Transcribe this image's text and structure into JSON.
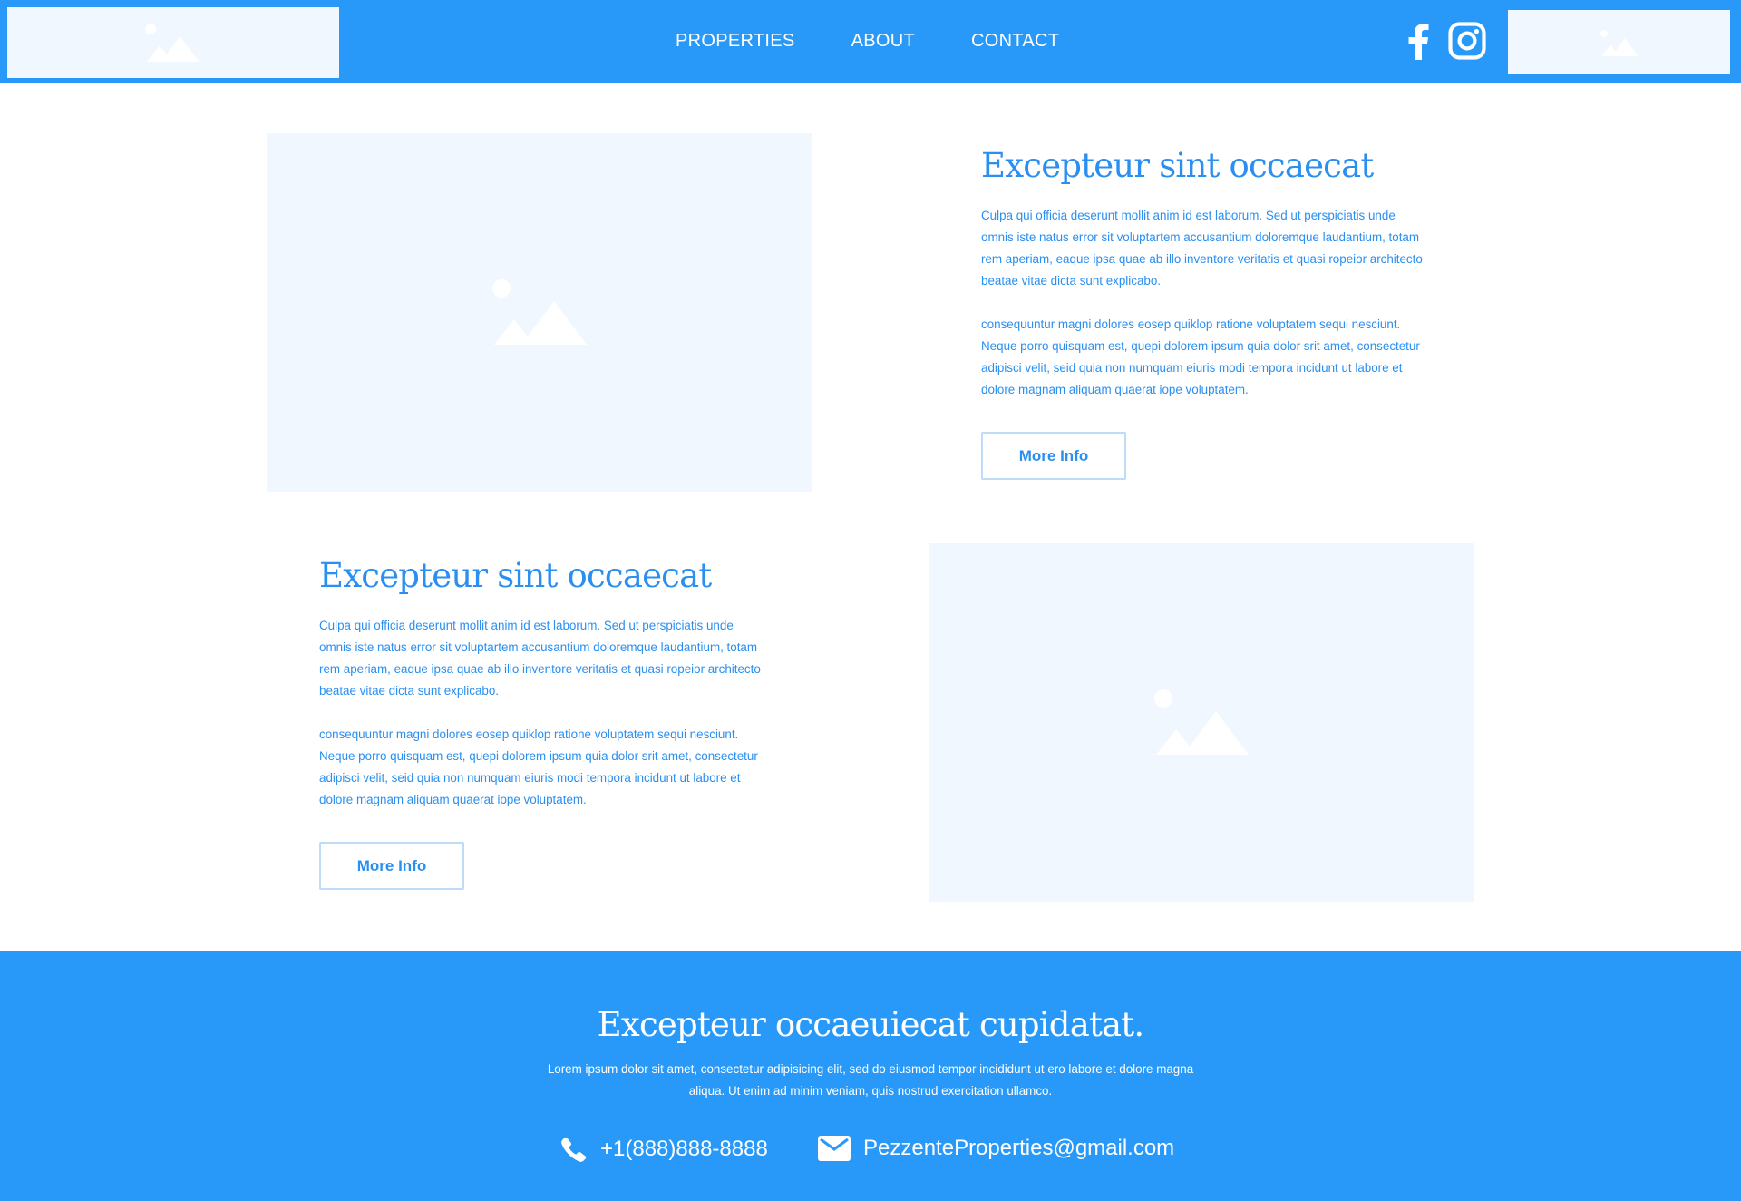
{
  "nav": {
    "items": [
      "PROPERTIES",
      "ABOUT",
      "CONTACT"
    ]
  },
  "social": {
    "facebook": "facebook-icon",
    "instagram": "instagram-icon"
  },
  "sections": [
    {
      "title": "Excepteur sint occaecat",
      "paragraph1": "Culpa qui officia deserunt mollit anim id est laborum. Sed ut perspiciatis unde omnis iste natus error sit voluptartem accusantium doloremque laudantium, totam rem aperiam, eaque ipsa quae ab illo inventore veritatis et quasi ropeior architecto beatae vitae dicta sunt explicabo.",
      "paragraph2": "consequuntur magni dolores eosep quiklop ratione voluptatem sequi nesciunt. Neque porro quisquam est, quepi dolorem ipsum quia dolor srit amet, consectetur adipisci velit, seid quia non numquam eiuris modi tempora incidunt ut labore et dolore magnam aliquam quaerat iope voluptatem.",
      "button": "More Info"
    },
    {
      "title": "Excepteur sint occaecat",
      "paragraph1": "Culpa qui officia deserunt mollit anim id est laborum. Sed ut perspiciatis unde omnis iste natus error sit voluptartem accusantium doloremque laudantium, totam rem aperiam, eaque ipsa quae ab illo inventore veritatis et quasi ropeior architecto beatae vitae dicta sunt explicabo.",
      "paragraph2": "consequuntur magni dolores eosep quiklop ratione voluptatem sequi nesciunt. Neque porro quisquam est, quepi dolorem ipsum quia dolor srit amet, consectetur adipisci velit, seid quia non numquam eiuris modi tempora incidunt ut labore et dolore magnam aliquam quaerat iope voluptatem.",
      "button": "More Info"
    }
  ],
  "footer": {
    "title": "Excepteur occaeuiecat cupidatat.",
    "description": "Lorem ipsum dolor sit amet, consectetur adipisicing elit, sed do eiusmod tempor incididunt ut ero labore et dolore magna aliqua. Ut enim ad minim veniam, quis nostrud exercitation ullamco.",
    "phone": "+1(888)888-8888",
    "email": "PezzenteProperties@gmail.com"
  },
  "colors": {
    "brand_blue": "#2899f8",
    "text_blue": "#2a8ff0",
    "placeholder_bg": "#f0f7fe"
  }
}
